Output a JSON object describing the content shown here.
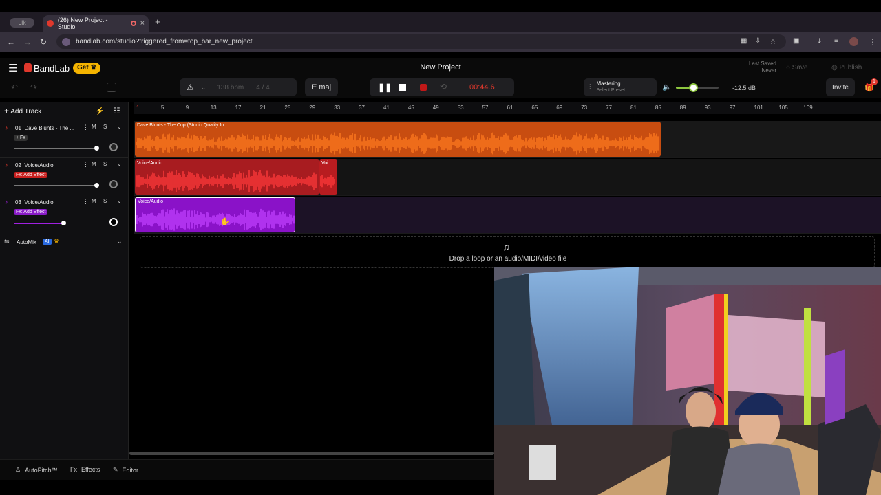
{
  "browser": {
    "inactive_tab": "Lik",
    "active_tab": "(26) New Project - Studio",
    "new_tab": "+",
    "close": "×",
    "url": "bandlab.com/studio?triggered_from=top_bar_new_project"
  },
  "app": {
    "brand": "BandLab",
    "get_label": "Get",
    "project_title": "New Project",
    "last_saved_label": "Last Saved",
    "last_saved_value": "Never",
    "save_label": "Save",
    "publish_label": "Publish",
    "invite_label": "Invite",
    "gift_badge": "1"
  },
  "transport": {
    "tempo": "138 bpm",
    "time_signature": "4 / 4",
    "key": "E maj",
    "time": "00:44.6",
    "mastering_label": "Mastering",
    "mastering_preset": "Select Preset",
    "volume_db": "-12.5 dB",
    "volume_level": 0.4
  },
  "sidebar": {
    "add_track": "Add Track",
    "automix": "AutoMix",
    "ai_badge": "AI"
  },
  "tracks": [
    {
      "number": "01",
      "name": "Dave Blunts - The ...",
      "fx": "+ Fx",
      "color": "#ff6a1a",
      "clip_label": "Dave Blunts - The Cup (Studio Quality In"
    },
    {
      "number": "02",
      "name": "Voice/Audio",
      "fx": "Fx: Add Effect",
      "color": "#e0282c",
      "clip_label": "Voice/Audio",
      "clip_label_2": "Voi..."
    },
    {
      "number": "03",
      "name": "Voice/Audio",
      "fx": "Fx: Add Effect",
      "color": "#a020e0",
      "clip_label": "Voice/Audio"
    }
  ],
  "ruler": [
    "1",
    "5",
    "9",
    "13",
    "17",
    "21",
    "25",
    "29",
    "33",
    "37",
    "41",
    "45",
    "49",
    "53",
    "57",
    "61",
    "65",
    "69",
    "73",
    "77",
    "81",
    "85",
    "89",
    "93",
    "97",
    "101",
    "105",
    "109"
  ],
  "dropzone": {
    "text": "Drop a loop or an audio/MIDI/video file"
  },
  "bottom": {
    "autopitch": "AutoPitch™",
    "effects": "Effects",
    "editor": "Editor"
  },
  "mute_label": "M",
  "solo_label": "S"
}
